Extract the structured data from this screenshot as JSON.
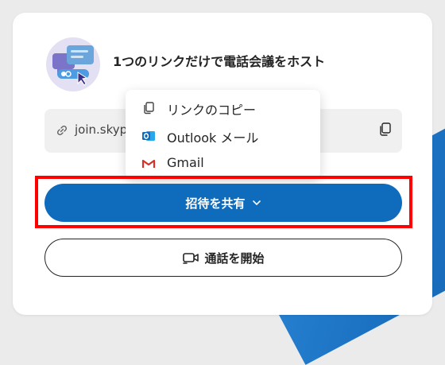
{
  "headline": "1つのリンクだけで電話会議をホスト",
  "link": {
    "text": "join.skyp",
    "icons": {
      "link": "link-icon",
      "copy": "copy-icon"
    }
  },
  "share_menu": {
    "items": [
      {
        "label": "リンクのコピー",
        "icon": "copy-icon"
      },
      {
        "label": "Outlook メール",
        "icon": "outlook-icon",
        "color": "#0f6cbd"
      },
      {
        "label": "Gmail",
        "icon": "gmail-icon",
        "color": "#d93025"
      }
    ]
  },
  "buttons": {
    "share_label": "招待を共有",
    "start_label": "通話を開始"
  },
  "colors": {
    "accent": "#0f6cbd",
    "highlight": "#ff0000",
    "card_bg": "#ffffff",
    "link_bg": "#f0f0f0"
  }
}
